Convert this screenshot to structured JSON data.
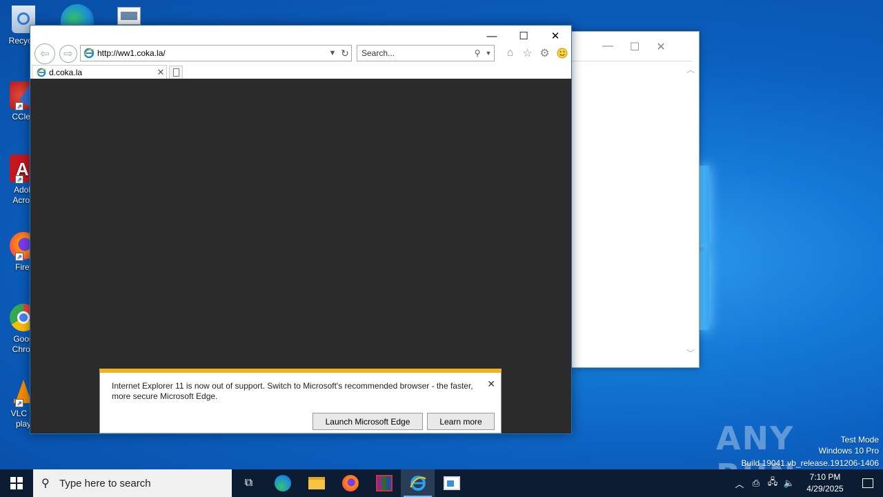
{
  "desktop": {
    "icons": [
      {
        "label": "Recycle",
        "icon": "recycle-bin-icon"
      },
      {
        "label": "CClea",
        "icon": "ccleaner-icon"
      },
      {
        "label": "Adob Acrob",
        "icon": "adobe-acrobat-icon"
      },
      {
        "label": "Firef",
        "icon": "firefox-icon"
      },
      {
        "label": "Goog Chron",
        "icon": "chrome-icon"
      },
      {
        "label": "VLC m play",
        "icon": "vlc-icon"
      }
    ],
    "top_icons": [
      "edge-icon",
      "file-icon"
    ]
  },
  "ie_window": {
    "url": "http://ww1.coka.la/",
    "search_placeholder": "Search...",
    "tab_title": "d.coka.la",
    "content_bg": "#2b2b2b"
  },
  "notification": {
    "message": "Internet Explorer 11 is now out of support. Switch to Microsoft's recommended browser - the faster, more secure Microsoft Edge.",
    "launch_label": "Launch Microsoft Edge",
    "learn_label": "Learn more",
    "accent": "#f2b21a"
  },
  "watermark": {
    "brand": "ANY RUN",
    "mode": "Test Mode",
    "edition": "Windows 10 Pro",
    "build": "Build 19041.vb_release.191206-1406"
  },
  "taskbar": {
    "search_placeholder": "Type here to search",
    "time": "7:10 PM",
    "date": "4/29/2025",
    "apps": [
      "task-view-icon",
      "edge-icon",
      "file-explorer-icon",
      "firefox-icon",
      "winrar-icon",
      "internet-explorer-icon",
      "app-window-icon"
    ]
  }
}
